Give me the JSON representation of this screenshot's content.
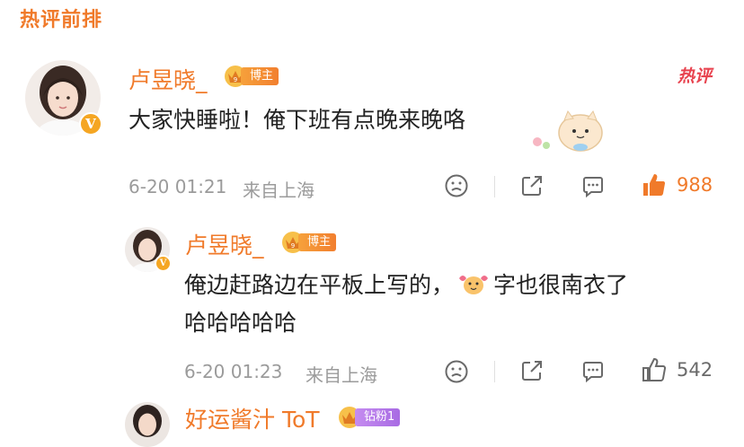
{
  "section_title": "热评前排",
  "comments": [
    {
      "username": "卢昱晓_",
      "badge": "博主",
      "hot_tag": "热评",
      "text": "大家快睡啦！俺下班有点晚来晚咯",
      "time": "6-20 01:21",
      "location": "来自上海",
      "likes": "988",
      "liked": true
    },
    {
      "username": "卢昱晓_",
      "badge": "博主",
      "text_part1": "俺边赶路边在平板上写的，",
      "text_part2": "字也很南衣了",
      "text_line2": "哈哈哈哈哈",
      "time": "6-20 01:23",
      "location": "来自上海",
      "likes": "542",
      "liked": false
    },
    {
      "username": "好运酱汁 ToT",
      "badge": "钻粉1"
    }
  ],
  "colors": {
    "accent": "#f07a2a",
    "like_active": "#f07a2a",
    "hot": "#e8434f",
    "meta": "#9b9b9b"
  }
}
